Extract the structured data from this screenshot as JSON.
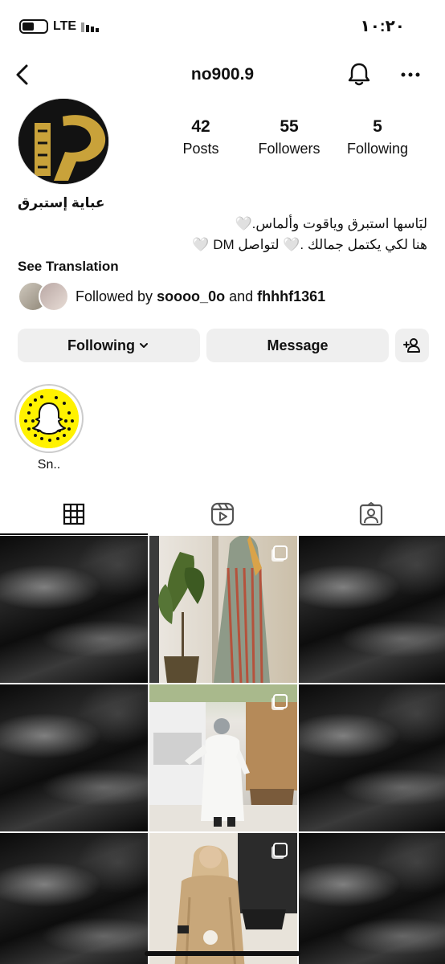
{
  "status_bar": {
    "network": "LTE",
    "time": "١٠:٢٠"
  },
  "header": {
    "username": "no900.9"
  },
  "stats": [
    {
      "count": "42",
      "label": "Posts"
    },
    {
      "count": "55",
      "label": "Followers"
    },
    {
      "count": "5",
      "label": "Following"
    }
  ],
  "bio": {
    "name": "عباية إستبرق",
    "line1": "لبَاسها استبرق وياقوت وألماس.🤍",
    "line2": "هنا لكي يكتمل جمالك .🤍 لتواصل DM 🤍",
    "see_translation": "See Translation"
  },
  "followed_by": {
    "prefix": "Followed by",
    "user1": "soooo_0o",
    "conjunction": "and",
    "user2": "fhhhf1361"
  },
  "buttons": {
    "following": "Following",
    "message": "Message"
  },
  "highlights": [
    {
      "label": "Sn.."
    }
  ],
  "tabs": [
    "grid-icon",
    "reels-icon",
    "tagged-icon"
  ],
  "colors": {
    "button_bg": "#efefef",
    "snap_yellow": "#fff200"
  }
}
